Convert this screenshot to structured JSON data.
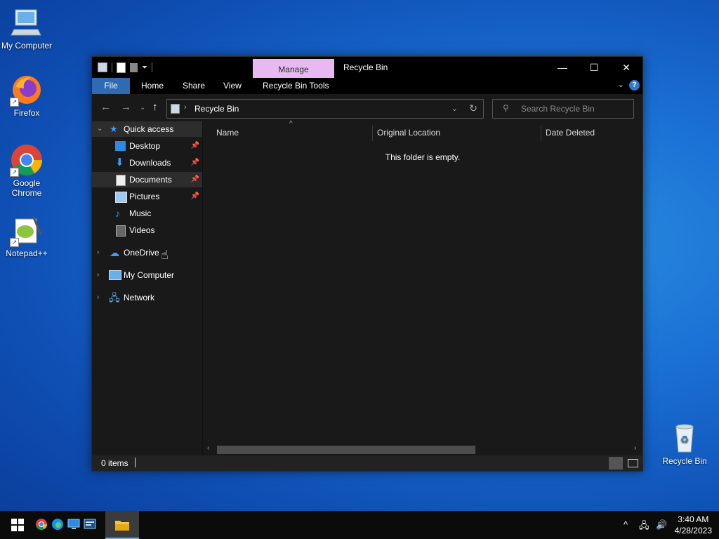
{
  "desktop": {
    "icons": [
      {
        "label": "My Computer"
      },
      {
        "label": "Firefox"
      },
      {
        "label": "Google Chrome"
      },
      {
        "label": "Notepad++"
      },
      {
        "label": "Recycle Bin"
      }
    ]
  },
  "window": {
    "title": "Recycle Bin",
    "manage_tab": "Manage",
    "ribbon_tabs": [
      "File",
      "Home",
      "Share",
      "View",
      "Recycle Bin Tools"
    ],
    "address": "Recycle Bin",
    "search_placeholder": "Search Recycle Bin",
    "nav": {
      "quick_access": "Quick access",
      "items": [
        {
          "label": "Desktop",
          "pinned": true
        },
        {
          "label": "Downloads",
          "pinned": true
        },
        {
          "label": "Documents",
          "pinned": true
        },
        {
          "label": "Pictures",
          "pinned": true
        },
        {
          "label": "Music",
          "pinned": false
        },
        {
          "label": "Videos",
          "pinned": false
        }
      ],
      "roots": [
        "OneDrive",
        "My Computer",
        "Network"
      ]
    },
    "columns": [
      "Name",
      "Original Location",
      "Date Deleted"
    ],
    "empty_message": "This folder is empty.",
    "status": "0 items"
  },
  "taskbar": {
    "time": "3:40 AM",
    "date": "4/28/2023"
  },
  "colors": {
    "manage_tab": "#e8b9f0",
    "file_tab": "#2e6bb3",
    "window_bg": "#191919"
  }
}
